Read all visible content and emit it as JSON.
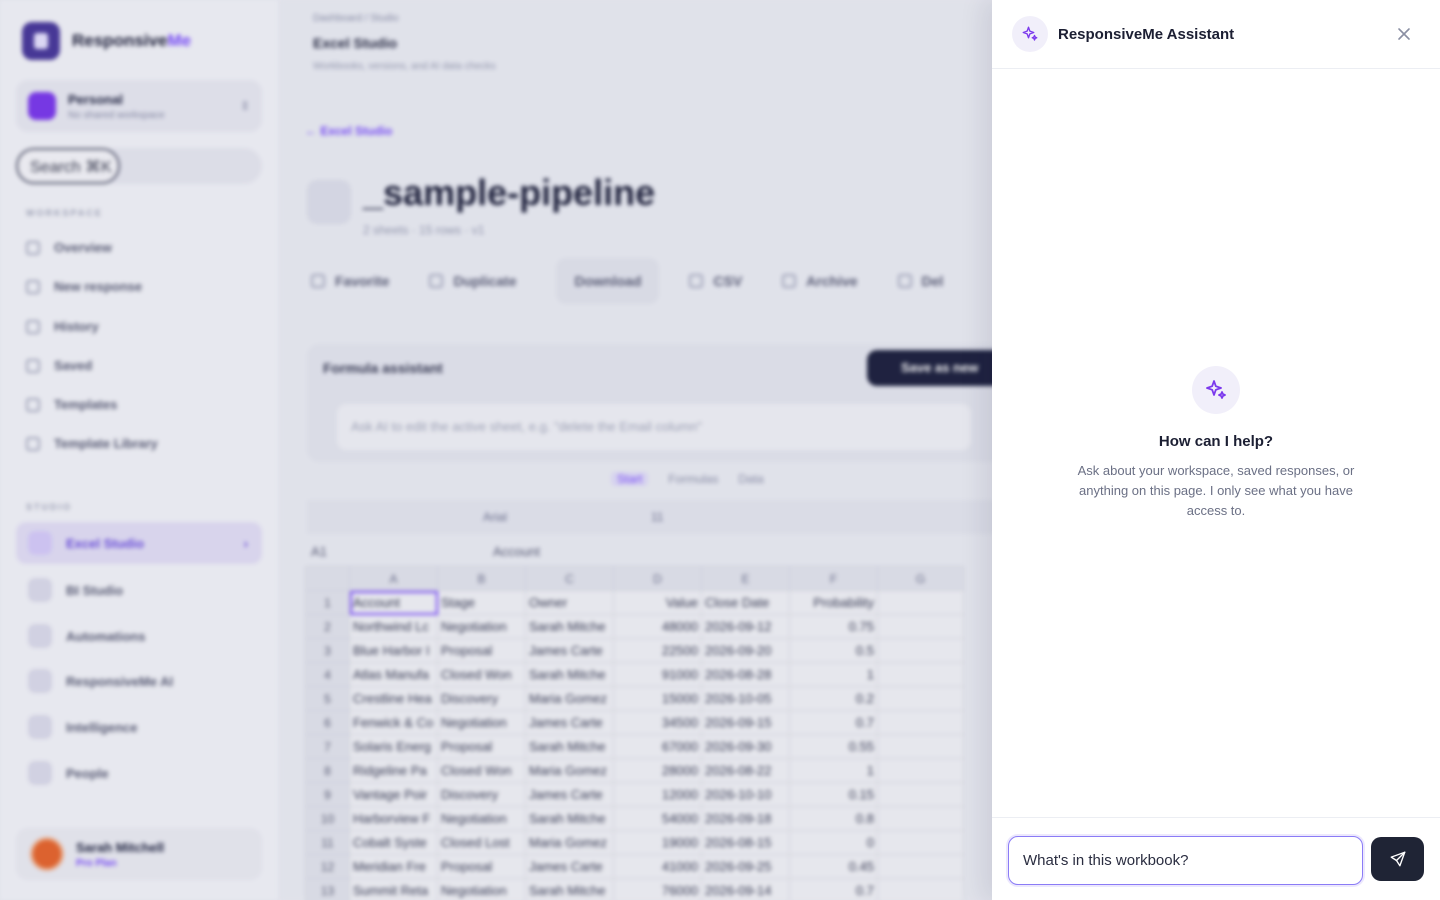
{
  "app": {
    "brand": {
      "name": "Responsive",
      "name_accent": "Me"
    },
    "workspace": {
      "name": "Personal",
      "subtitle": "No shared workspace"
    },
    "search": {
      "label": "Search ⌘K"
    },
    "sidebar": {
      "workspace_label": "WORKSPACE",
      "workspace_items": [
        {
          "label": "Overview",
          "icon": "grid-icon"
        },
        {
          "label": "New response",
          "icon": "rocket-icon"
        },
        {
          "label": "History",
          "icon": "history-icon"
        },
        {
          "label": "Saved",
          "icon": "bookmark-icon"
        },
        {
          "label": "Templates",
          "icon": "file-icon"
        },
        {
          "label": "Template Library",
          "icon": "library-icon"
        }
      ],
      "studio_label": "STUDIO",
      "studio_items": [
        {
          "label": "Excel Studio",
          "active": true
        },
        {
          "label": "BI Studio"
        },
        {
          "label": "Automations"
        },
        {
          "label": "ResponsiveMe AI"
        },
        {
          "label": "Intelligence"
        },
        {
          "label": "People"
        }
      ]
    },
    "user": {
      "name": "Sarah Mitchell",
      "plan": "Pro Plan"
    }
  },
  "main": {
    "breadcrumb": "Dashboard  /  Studio",
    "page_title": "Excel Studio",
    "page_subtitle": "Workbooks, versions, and AI data checks",
    "back_link": "← Excel Studio",
    "doc": {
      "title": "_sample-pipeline",
      "meta": "2 sheets · 15 rows · v1"
    },
    "toolbar": [
      "Favorite",
      "Duplicate",
      "Download",
      "CSV",
      "Archive",
      "Del"
    ],
    "formula_assistant": {
      "title": "Formula assistant",
      "save_button": "Save as new",
      "placeholder": "Ask AI to edit the active sheet, e.g. \"delete the Email column\""
    },
    "ribbon_tabs": [
      "Start",
      "Formulas",
      "Data"
    ],
    "font": "Arial",
    "font_size": "11",
    "cell_ref": "A1",
    "cell_value": "Account",
    "columns": [
      "A",
      "B",
      "C",
      "D",
      "E",
      "F",
      "G"
    ],
    "rows": [
      [
        "1",
        "Account",
        "Stage",
        "Owner",
        "Value",
        "Close Date",
        "Probability"
      ],
      [
        "2",
        "Northwind Lc",
        "Negotiation",
        "Sarah Mitche",
        "48000",
        "2026-09-12",
        "0.75"
      ],
      [
        "3",
        "Blue Harbor I",
        "Proposal",
        "James Carte",
        "22500",
        "2026-09-20",
        "0.5"
      ],
      [
        "4",
        "Atlas Manufa",
        "Closed Won",
        "Sarah Mitche",
        "91000",
        "2026-08-28",
        "1"
      ],
      [
        "5",
        "Crestline Hea",
        "Discovery",
        "Maria Gomez",
        "15000",
        "2026-10-05",
        "0.2"
      ],
      [
        "6",
        "Fenwick & Co",
        "Negotiation",
        "James Carte",
        "34500",
        "2026-09-15",
        "0.7"
      ],
      [
        "7",
        "Solaris Energ",
        "Proposal",
        "Sarah Mitche",
        "67000",
        "2026-09-30",
        "0.55"
      ],
      [
        "8",
        "Ridgeline Pa",
        "Closed Won",
        "Maria Gomez",
        "28000",
        "2026-08-22",
        "1"
      ],
      [
        "9",
        "Vantage Poir",
        "Discovery",
        "James Carte",
        "12000",
        "2026-10-10",
        "0.15"
      ],
      [
        "10",
        "Harborview F",
        "Negotiation",
        "Sarah Mitche",
        "54000",
        "2026-09-18",
        "0.8"
      ],
      [
        "11",
        "Cobalt Syste",
        "Closed Lost",
        "Maria Gomez",
        "19000",
        "2026-08-15",
        "0"
      ],
      [
        "12",
        "Meridian Fre",
        "Proposal",
        "James Carte",
        "41000",
        "2026-09-25",
        "0.45"
      ],
      [
        "13",
        "Summit Reta",
        "Negotiation",
        "Sarah Mitche",
        "76000",
        "2026-09-14",
        "0.7"
      ]
    ]
  },
  "assistant": {
    "title": "ResponsiveMe Assistant",
    "empty_title": "How can I help?",
    "empty_description": "Ask about your workspace, saved responses, or anything on this page. I only see what you have access to.",
    "input_value": "What's in this workbook?",
    "accent_color": "#7c3aed",
    "send_button_color": "#1f2435"
  }
}
